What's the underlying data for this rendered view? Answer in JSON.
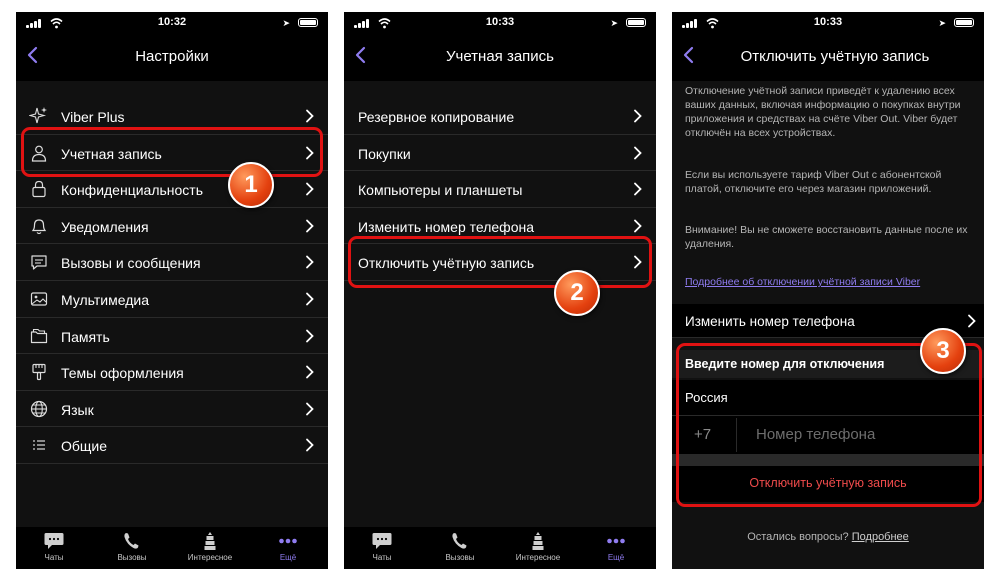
{
  "status_bar": {
    "time_1": "10:32",
    "time_2": "10:33",
    "time_3": "10:33"
  },
  "screen1": {
    "title": "Настройки",
    "items": [
      {
        "label": "Viber Plus",
        "icon": "sparkle-icon"
      },
      {
        "label": "Учетная запись",
        "icon": "person-icon"
      },
      {
        "label": "Конфиденциальность",
        "icon": "lock-icon"
      },
      {
        "label": "Уведомления",
        "icon": "bell-icon"
      },
      {
        "label": "Вызовы и сообщения",
        "icon": "chat-icon"
      },
      {
        "label": "Мультимедиа",
        "icon": "photo-icon"
      },
      {
        "label": "Память",
        "icon": "folder-icon"
      },
      {
        "label": "Темы оформления",
        "icon": "brush-icon"
      },
      {
        "label": "Язык",
        "icon": "globe-icon"
      },
      {
        "label": "Общие",
        "icon": "list-icon"
      }
    ]
  },
  "screen2": {
    "title": "Учетная запись",
    "items": [
      {
        "label": "Резервное копирование"
      },
      {
        "label": "Покупки"
      },
      {
        "label": "Компьютеры и планшеты"
      },
      {
        "label": "Изменить номер телефона"
      },
      {
        "label": "Отключить учётную запись"
      }
    ]
  },
  "screen3": {
    "title": "Отключить учётную запись",
    "paragraph1": "Отключение учётной записи приведёт к удалению всех ваших данных, включая информацию о покупках внутри приложения и средствах на счёте Viber Out. Viber будет отключён на всех устройствах.",
    "paragraph2": "Если вы используете тариф Viber Out с абонентской платой, отключите его через магазин приложений.",
    "paragraph3": "Внимание! Вы не сможете восстановить данные после их удаления.",
    "learn_more_link": "Подробнее об отключении учётной записи Viber",
    "change_number": "Изменить номер телефона",
    "enter_number_header": "Введите номер для отключения",
    "country": "Россия",
    "country_code": "+7",
    "phone_placeholder": "Номер телефона",
    "deactivate_button": "Отключить учётную запись",
    "questions_text": "Остались вопросы?",
    "questions_link": "Подробнее"
  },
  "tabbar": {
    "chats": "Чаты",
    "calls": "Вызовы",
    "explore": "Интересное",
    "more": "Ещё"
  },
  "badges": {
    "b1": "1",
    "b2": "2",
    "b3": "3"
  },
  "colors": {
    "accent": "#8f7cf0",
    "highlight": "#e01212",
    "danger": "#ef4b4b",
    "badge": "#e4410f"
  }
}
